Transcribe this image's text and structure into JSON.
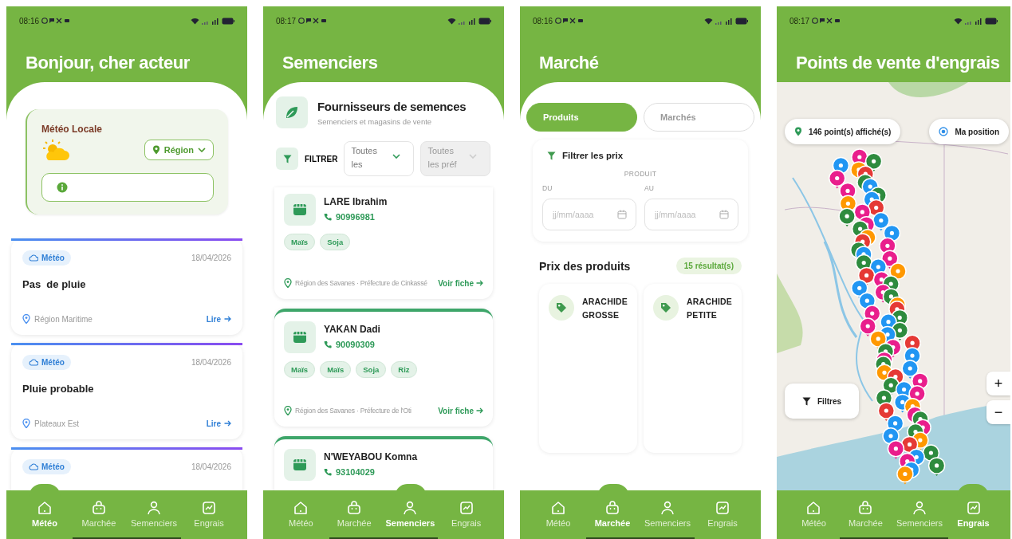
{
  "phones": [
    {
      "kind": "meteo",
      "status_time": "08:16",
      "title": "Bonjour, cher acteur",
      "local": {
        "title": "Météo Locale",
        "region_button": "Région"
      },
      "news": [
        {
          "tag": "Météo",
          "date": "18/04/2026",
          "title": "Pas  de pluie",
          "location": "Région Maritime",
          "link": "Lire"
        },
        {
          "tag": "Météo",
          "date": "18/04/2026",
          "title": "Pluie probable",
          "location": "Plateaux Est",
          "link": "Lire"
        },
        {
          "tag": "Météo",
          "date": "18/04/2026"
        }
      ],
      "nav": [
        {
          "label": "Météo",
          "selected": true
        },
        {
          "label": "Marchée",
          "selected": false
        },
        {
          "label": "Semenciers",
          "selected": false
        },
        {
          "label": "Engrais",
          "selected": false
        }
      ]
    },
    {
      "kind": "seeds",
      "status_time": "08:17",
      "title": "Semenciers",
      "header": {
        "title": "Fournisseurs de semences",
        "subtitle": "Semenciers et magasins de vente"
      },
      "filter_label": "FILTRER",
      "selects": [
        {
          "value": "Toutes les",
          "disabled": false
        },
        {
          "value": "Toutes les préf",
          "disabled": true
        }
      ],
      "suppliers": [
        {
          "name": "LARE Ibrahim",
          "phone": "90996981",
          "tags": [
            "Maïs",
            "Soja"
          ],
          "location": "Région des Savanes · Préfecture de Cinkassé",
          "link": "Voir fiche"
        },
        {
          "name": "YAKAN Dadi",
          "phone": "90090309",
          "tags": [
            "Maïs",
            "Maïs",
            "Soja",
            "Riz"
          ],
          "location": "Région des Savanes · Préfecture de l'Oti",
          "link": "Voir fiche"
        },
        {
          "name": "N'WEYABOU Komna",
          "phone": "93104029"
        }
      ],
      "nav": [
        {
          "label": "Météo",
          "selected": false
        },
        {
          "label": "Marchée",
          "selected": false
        },
        {
          "label": "Semenciers",
          "selected": true
        },
        {
          "label": "Engrais",
          "selected": false
        }
      ]
    },
    {
      "kind": "market",
      "status_time": "08:16",
      "title": "Marché",
      "segments": [
        {
          "label": "Produits",
          "selected": true
        },
        {
          "label": "Marchés",
          "selected": false
        }
      ],
      "filter": {
        "title": "Filtrer les prix",
        "product_label": "PRODUIT",
        "dates": [
          {
            "label": "DU",
            "placeholder": "jj/mm/aaaa"
          },
          {
            "label": "AU",
            "placeholder": "jj/mm/aaaa"
          }
        ]
      },
      "section_title": "Prix des produits",
      "result_count": "15 résultat(s)",
      "products": [
        "ARACHIDE GROSSE",
        "ARACHIDE PETITE"
      ],
      "nav": [
        {
          "label": "Météo",
          "selected": false
        },
        {
          "label": "Marchée",
          "selected": true
        },
        {
          "label": "Semenciers",
          "selected": false
        },
        {
          "label": "Engrais",
          "selected": false
        }
      ]
    },
    {
      "kind": "map",
      "status_time": "08:17",
      "title": "Points de vente d'engrais",
      "points_count": "146 point(s) affiché(s)",
      "position_button": "Ma position",
      "filters_button": "Filtres",
      "zoom": [
        "+",
        "−"
      ],
      "nav": [
        {
          "label": "Météo",
          "selected": false
        },
        {
          "label": "Marchée",
          "selected": false
        },
        {
          "label": "Semenciers",
          "selected": false
        },
        {
          "label": "Engrais",
          "selected": true
        }
      ]
    }
  ]
}
